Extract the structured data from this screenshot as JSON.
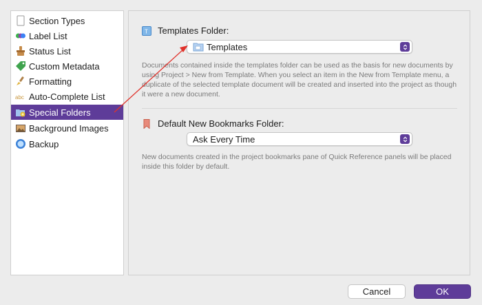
{
  "sidebar": {
    "items": [
      {
        "label": "Section Types",
        "icon": "section-types-icon"
      },
      {
        "label": "Label List",
        "icon": "label-list-icon"
      },
      {
        "label": "Status List",
        "icon": "status-list-icon"
      },
      {
        "label": "Custom Metadata",
        "icon": "custom-metadata-icon"
      },
      {
        "label": "Formatting",
        "icon": "formatting-brush-icon"
      },
      {
        "label": "Auto-Complete List",
        "icon": "abc-icon"
      },
      {
        "label": "Special Folders",
        "icon": "special-folders-icon",
        "selected": true
      },
      {
        "label": "Background Images",
        "icon": "background-images-icon"
      },
      {
        "label": "Backup",
        "icon": "backup-icon"
      }
    ]
  },
  "templates": {
    "title": "Templates Folder:",
    "value": "Templates",
    "description": "Documents contained inside the templates folder can be used as the basis for new documents by using Project > New from Template. When you select an item in the New from Template menu, a duplicate of the selected template document will be created and inserted into the project as though it were a new document."
  },
  "bookmarks": {
    "title": "Default New Bookmarks Folder:",
    "value": "Ask Every Time",
    "description": "New documents created in the project bookmarks pane of Quick Reference panels will be placed inside this folder by default."
  },
  "buttons": {
    "cancel": "Cancel",
    "ok": "OK"
  },
  "colors": {
    "accent": "#5e3c99",
    "annotation_arrow": "#e0322b"
  }
}
